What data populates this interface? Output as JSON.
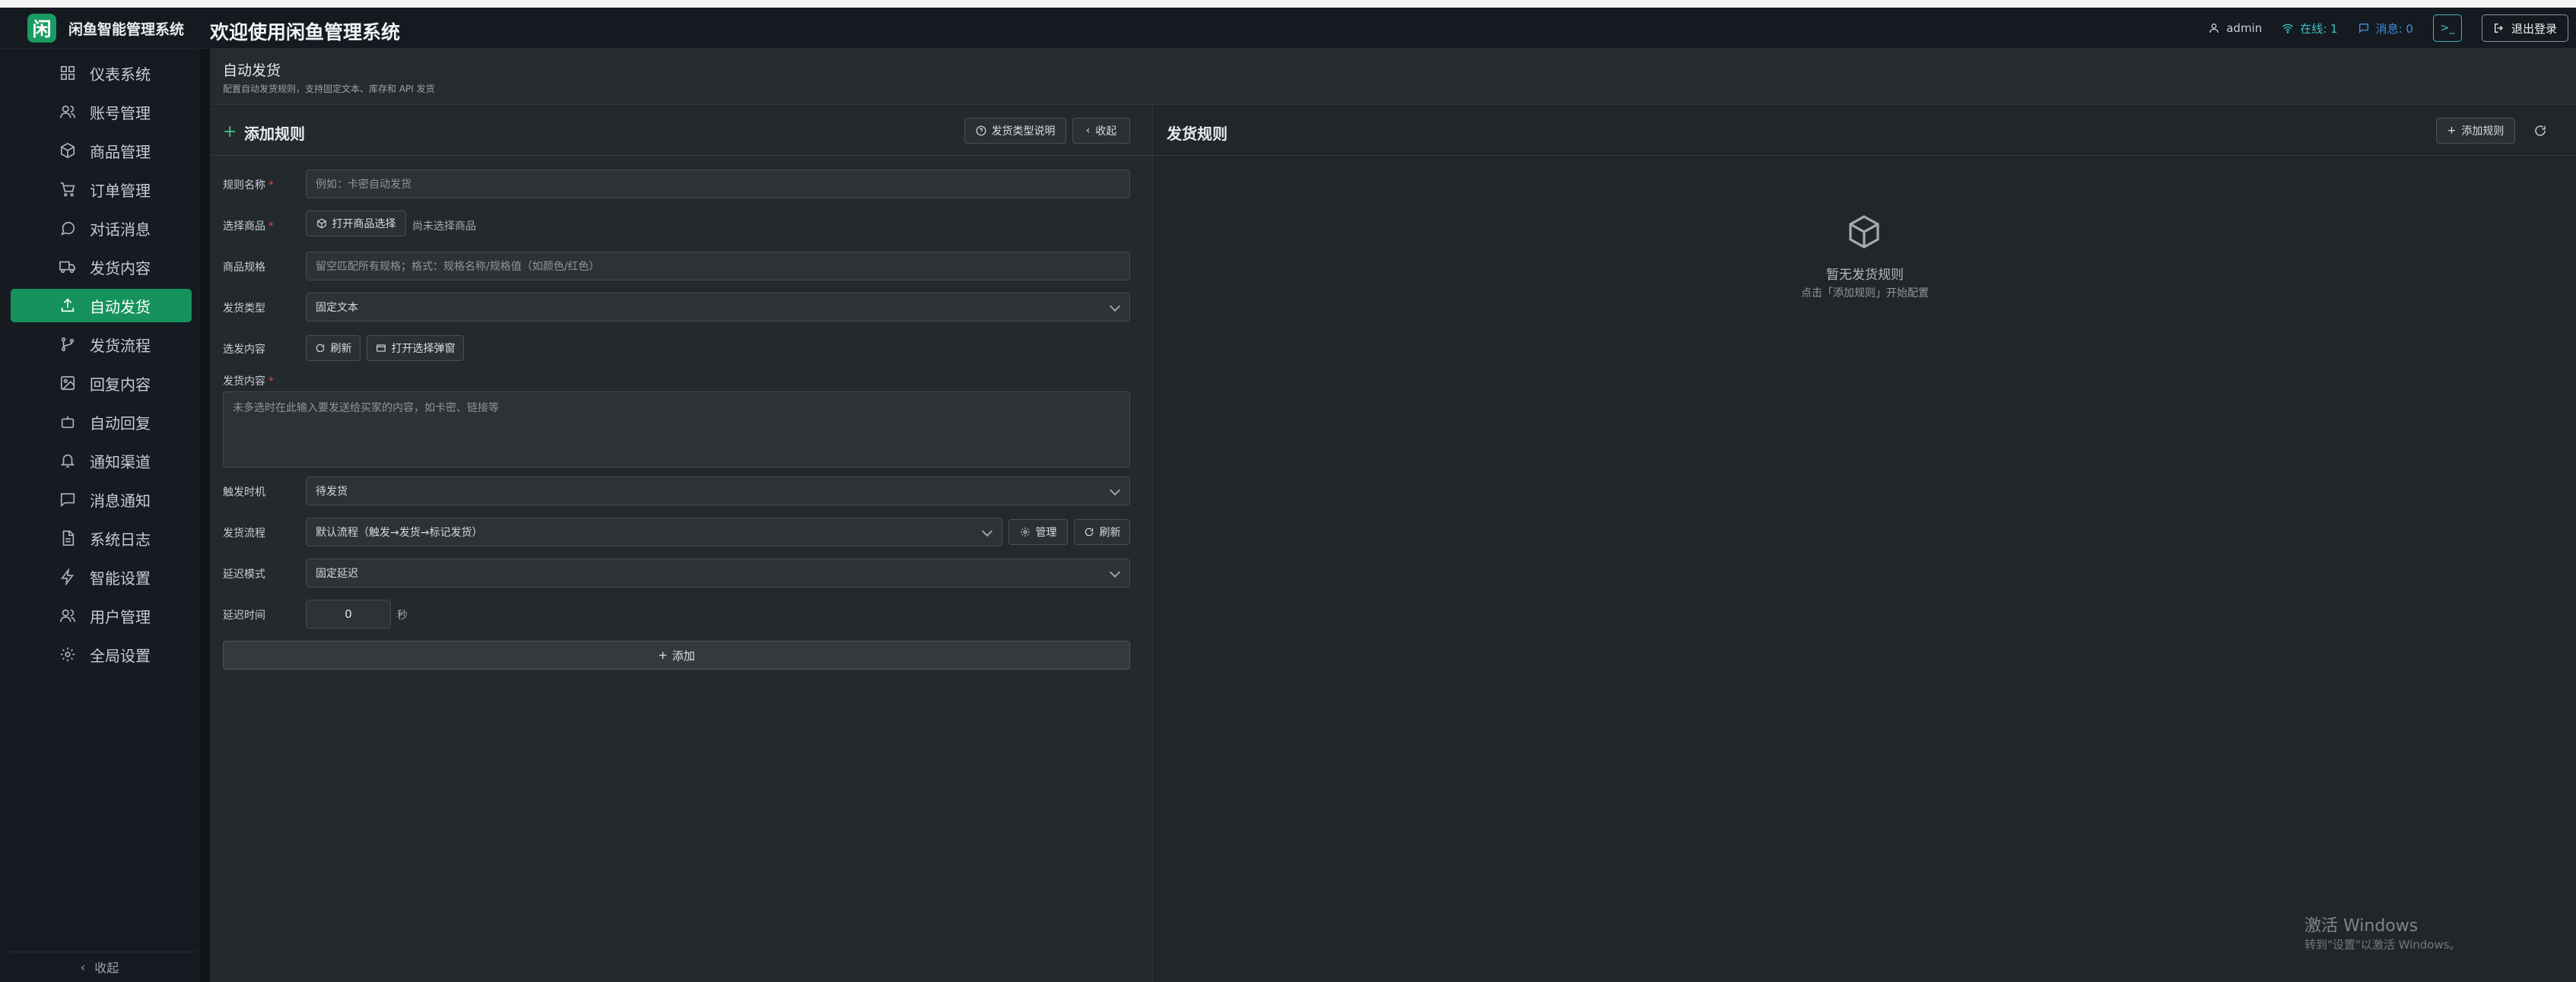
{
  "brand": {
    "logo_char": "闲",
    "name": "闲鱼智能管理系统",
    "accent": "#16935d"
  },
  "header": {
    "welcome": "欢迎使用闲鱼管理系统",
    "user": "admin",
    "online": "在线: 1",
    "messages": "消息: 0",
    "terminal": ">_",
    "logout": "退出登录"
  },
  "sidebar": {
    "items": [
      {
        "label": "仪表系统",
        "icon": "dashboard-icon"
      },
      {
        "label": "账号管理",
        "icon": "users-icon"
      },
      {
        "label": "商品管理",
        "icon": "box-icon"
      },
      {
        "label": "订单管理",
        "icon": "cart-icon"
      },
      {
        "label": "对话消息",
        "icon": "chat-icon"
      },
      {
        "label": "发货内容",
        "icon": "truck-icon"
      },
      {
        "label": "自动发货",
        "icon": "upload-icon",
        "active": true
      },
      {
        "label": "发货流程",
        "icon": "flow-icon"
      },
      {
        "label": "回复内容",
        "icon": "image-icon"
      },
      {
        "label": "自动回复",
        "icon": "robot-icon"
      },
      {
        "label": "通知渠道",
        "icon": "bell-icon"
      },
      {
        "label": "消息通知",
        "icon": "message-icon"
      },
      {
        "label": "系统日志",
        "icon": "file-icon"
      },
      {
        "label": "智能设置",
        "icon": "bolt-icon"
      },
      {
        "label": "用户管理",
        "icon": "user-group-icon"
      },
      {
        "label": "全局设置",
        "icon": "gear-icon"
      }
    ],
    "collapse": "收起"
  },
  "page": {
    "title": "自动发货",
    "subtitle": "配置自动发货规则，支持固定文本、库存和 API 发货"
  },
  "form": {
    "title": "添加规则",
    "type_help_btn": "发货类型说明",
    "collapse_btn": "收起",
    "rule_name_label": "规则名称",
    "rule_name_placeholder": "例如：卡密自动发货",
    "product_label": "选择商品",
    "open_product_btn": "打开商品选择",
    "product_none": "尚未选择商品",
    "spec_label": "商品规格",
    "spec_placeholder": "留空匹配所有规格；格式：规格名称/规格值（如颜色/红色）",
    "type_label": "发货类型",
    "type_value": "固定文本",
    "content_select_label": "选发内容",
    "refresh_btn": "刷新",
    "open_select_btn": "打开选择弹窗",
    "content_label": "发货内容",
    "content_placeholder": "未多选时在此输入要发送给买家的内容，如卡密、链接等",
    "trigger_label": "触发时机",
    "trigger_value": "待发货",
    "flow_label": "发货流程",
    "flow_value": "默认流程（触发→发货→标记发货）",
    "manage_btn": "管理",
    "flow_refresh_btn": "刷新",
    "delay_mode_label": "延迟模式",
    "delay_mode_value": "固定延迟",
    "delay_time_label": "延迟时间",
    "delay_time_value": "0",
    "delay_unit": "秒",
    "add_btn": "添加"
  },
  "rules": {
    "title": "发货规则",
    "add_btn": "添加规则",
    "empty_title": "暂无发货规则",
    "empty_hint": "点击「添加规则」开始配置"
  },
  "watermark": {
    "line1": "激活 Windows",
    "line2": "转到\"设置\"以激活 Windows。"
  }
}
